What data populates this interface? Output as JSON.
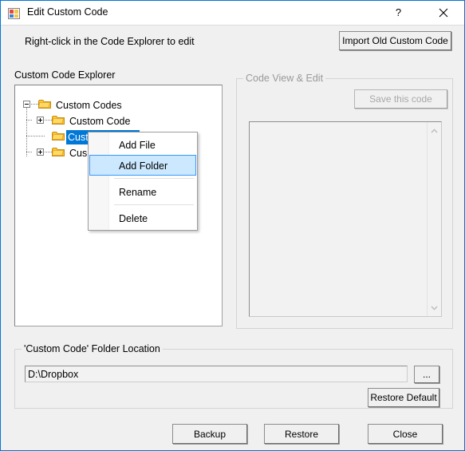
{
  "window": {
    "title": "Edit Custom Code",
    "icon": "app-window-icon",
    "accent_color": "#0078d7",
    "background_color": "#f0f0f0",
    "help_label": "?",
    "close_label": "close-icon"
  },
  "header": {
    "hint": "Right-click in the Code Explorer to edit",
    "import_button": "Import Old Custom Code"
  },
  "explorer": {
    "label": "Custom Code Explorer",
    "selection_color": "#0078d7",
    "nodes": [
      {
        "label": "Custom Codes",
        "state": "expanded",
        "toggle": "minus",
        "selected": false
      },
      {
        "label": "Custom Code",
        "state": "collapsed",
        "toggle": "plus",
        "selected": false
      },
      {
        "label": "Custom Code 2",
        "state": "leaf",
        "toggle": "none",
        "selected": true
      },
      {
        "label": "Cus",
        "state": "collapsed",
        "toggle": "plus",
        "selected": false
      }
    ]
  },
  "context_menu": {
    "hover_color": "#cce8ff",
    "items": [
      {
        "label": "Add File",
        "hovered": false,
        "separator_after": false
      },
      {
        "label": "Add Folder",
        "hovered": true,
        "separator_after": true
      },
      {
        "label": "Rename",
        "hovered": false,
        "separator_after": true
      },
      {
        "label": "Delete",
        "hovered": false,
        "separator_after": false
      }
    ]
  },
  "code_panel": {
    "title": "Code View & Edit",
    "enabled": false,
    "save_button": "Save this code",
    "content": "",
    "scroll_up_icon": "chevron-up-icon",
    "scroll_down_icon": "chevron-down-icon"
  },
  "folder_location": {
    "title": "'Custom Code' Folder Location",
    "path_value": "D:\\Dropbox",
    "path_placeholder": "",
    "browse_button": "...",
    "restore_default_button": "Restore Default"
  },
  "footer": {
    "backup_button": "Backup",
    "restore_button": "Restore",
    "close_button": "Close"
  }
}
